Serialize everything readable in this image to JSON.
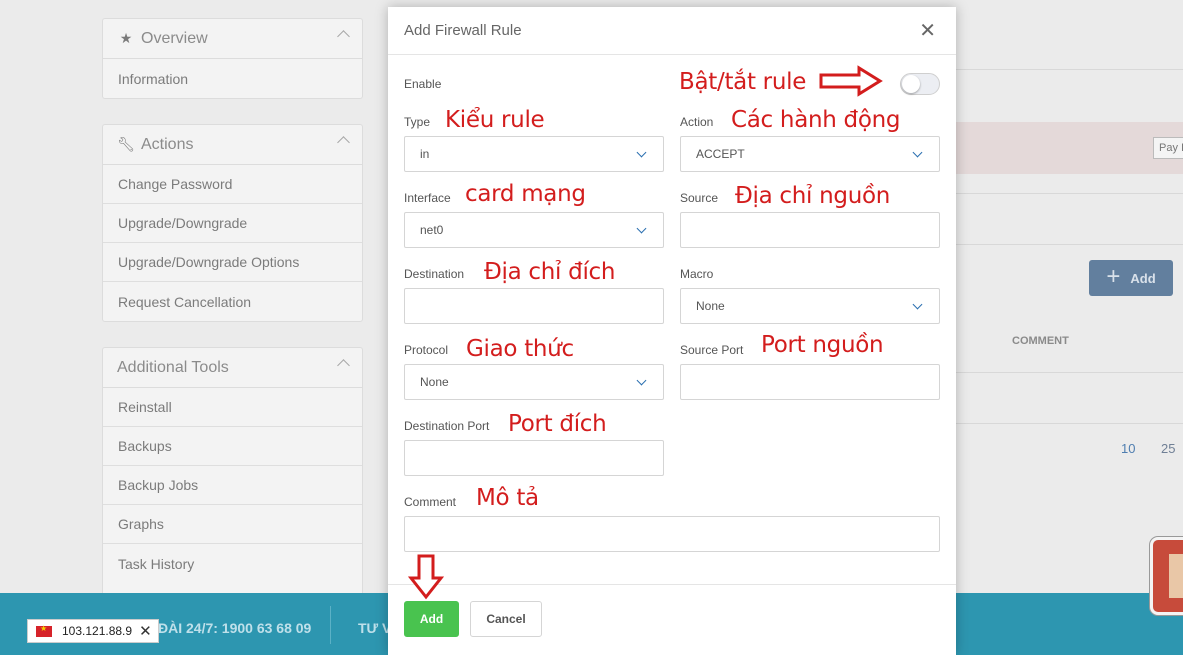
{
  "sidebar": {
    "overview": {
      "title": "Overview",
      "items": [
        "Information"
      ]
    },
    "actions": {
      "title": "Actions",
      "items": [
        "Change Password",
        "Upgrade/Downgrade",
        "Upgrade/Downgrade Options",
        "Request Cancellation"
      ]
    },
    "tools": {
      "title": "Additional Tools",
      "items": [
        "Reinstall",
        "Backups",
        "Backup Jobs",
        "Graphs",
        "Task History"
      ]
    }
  },
  "background": {
    "pay_label": "Pay I",
    "add_label": "Add",
    "comment_header": "COMMENT",
    "page_sizes": [
      "10",
      "25"
    ]
  },
  "footer": {
    "hotline": "ĐÀI 24/7: 1900 63 68 09",
    "tv": "TƯ V",
    "ip": "103.121.88.9"
  },
  "modal": {
    "title": "Add Firewall Rule",
    "fields": {
      "enable": {
        "label": "Enable",
        "value": false
      },
      "type": {
        "label": "Type",
        "value": "in"
      },
      "action": {
        "label": "Action",
        "value": "ACCEPT"
      },
      "interface": {
        "label": "Interface",
        "value": "net0"
      },
      "source": {
        "label": "Source",
        "value": ""
      },
      "destination": {
        "label": "Destination",
        "value": ""
      },
      "macro": {
        "label": "Macro",
        "value": "None"
      },
      "protocol": {
        "label": "Protocol",
        "value": "None"
      },
      "source_port": {
        "label": "Source Port",
        "value": ""
      },
      "destination_port": {
        "label": "Destination Port",
        "value": ""
      },
      "comment": {
        "label": "Comment",
        "value": ""
      }
    },
    "buttons": {
      "add": "Add",
      "cancel": "Cancel"
    }
  },
  "annotations": {
    "enable": "Bật/tắt rule",
    "type": "Kiểu rule",
    "action": "Các hành động",
    "interface": "card mạng",
    "source": "Địa chỉ nguồn",
    "destination": "Địa chỉ đích",
    "protocol": "Giao thức",
    "source_port": "Port nguồn",
    "destination_port": "Port đích",
    "comment": "Mô tả"
  },
  "colors": {
    "annotation": "#d31d1d",
    "add_button": "#49c34f",
    "footer": "#2d96b0",
    "caret": "#2a6fb0"
  }
}
